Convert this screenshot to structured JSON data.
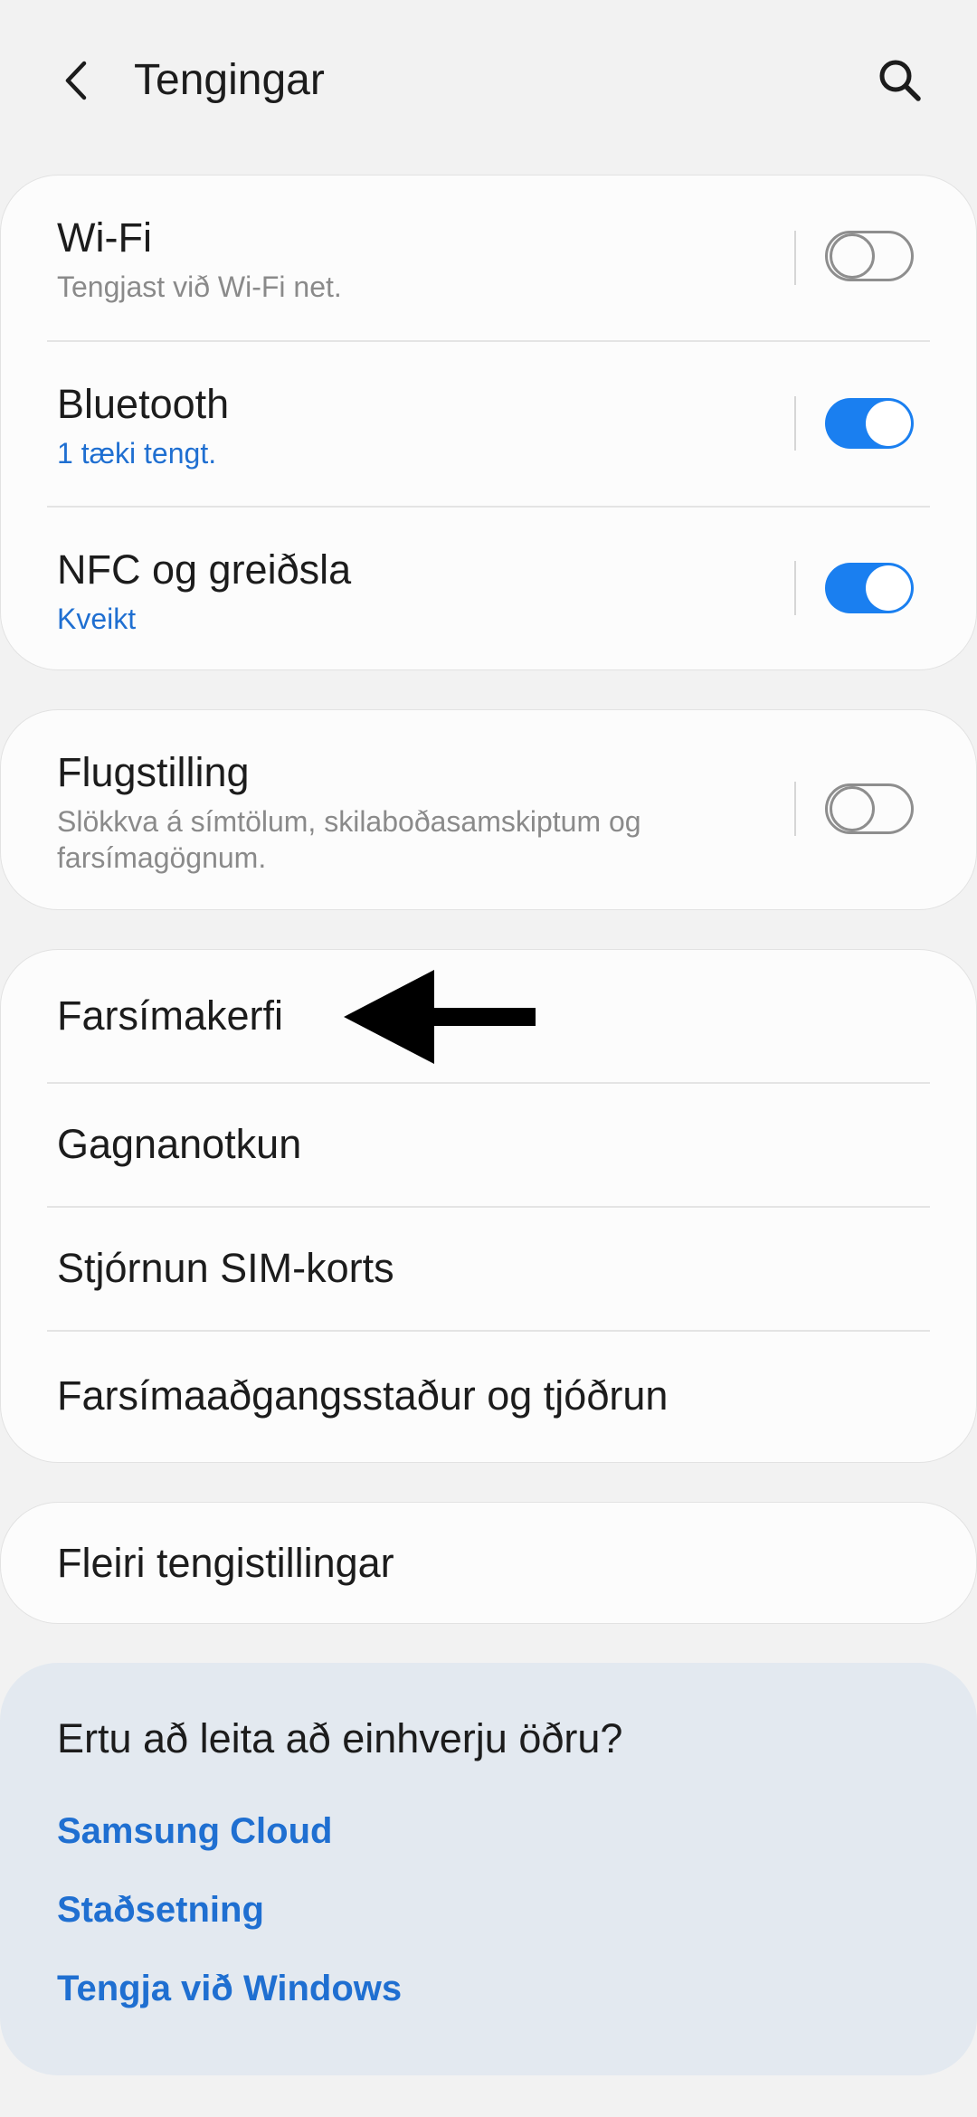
{
  "header": {
    "title": "Tengingar",
    "back_icon": "chevron-left-icon",
    "search_icon": "search-icon"
  },
  "colors": {
    "accent": "#1a7ff0",
    "link": "#1f6fd1",
    "background": "#f2f2f2",
    "card": "#fcfcfc",
    "help_card": "#e3e9f0"
  },
  "connectivity": [
    {
      "title": "Wi-Fi",
      "subtitle": "Tengjast við Wi-Fi net.",
      "toggle_on": false
    },
    {
      "title": "Bluetooth",
      "subtitle": "1 tæki tengt.",
      "toggle_on": true
    },
    {
      "title": "NFC og greiðsla",
      "subtitle": "Kveikt",
      "toggle_on": true
    }
  ],
  "airplane": {
    "title": "Flugstilling",
    "subtitle_line1": "Slökkva á símtölum, skilaboðasamskiptum og",
    "subtitle_line2": "farsímagögnum.",
    "toggle_on": false
  },
  "network_items": [
    "Farsímakerfi",
    "Gagnanotkun",
    "Stjórnun SIM-korts",
    "Farsímaaðgangsstaður og tjóðrun"
  ],
  "more": {
    "label": "Fleiri tengistillingar"
  },
  "help": {
    "title": "Ertu að leita að einhverju öðru?",
    "links": [
      "Samsung Cloud",
      "Staðsetning",
      "Tengja við Windows"
    ]
  }
}
